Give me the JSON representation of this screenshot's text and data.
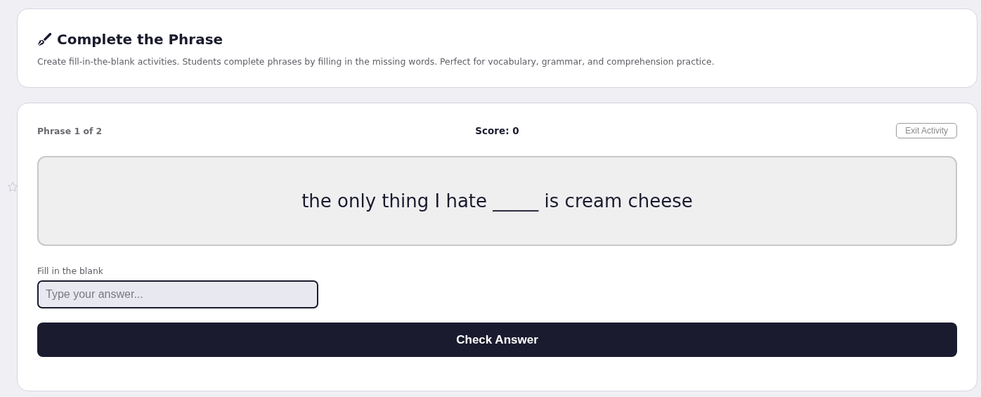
{
  "header": {
    "title": "Complete the Phrase",
    "description": "Create fill-in-the-blank activities. Students complete phrases by filling in the missing words. Perfect for vocabulary, grammar, and comprehension practice."
  },
  "activity": {
    "progress": "Phrase 1 of 2",
    "score": "Score: 0",
    "exit_button": "Exit Activity",
    "phrase": "the only thing I hate _____ is cream cheese",
    "answer_label": "Fill in the blank",
    "answer_placeholder": "Type your answer...",
    "check_button": "Check Answer"
  }
}
